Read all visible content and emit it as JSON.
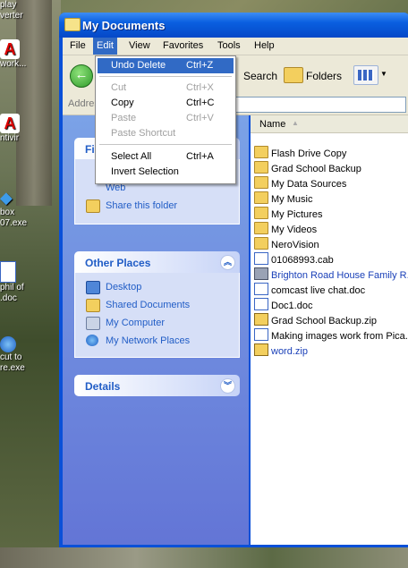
{
  "desktop": {
    "icons": [
      {
        "label": "play\nverter",
        "icon": "media-icon"
      },
      {
        "label": "work...",
        "icon": "antivirus-icon"
      },
      {
        "label": "ntivir",
        "icon": "antivirus-icon"
      },
      {
        "label": "box\n07.exe",
        "icon": "dropbox-icon"
      },
      {
        "label": "phil of\n.doc",
        "icon": "document-icon"
      },
      {
        "label": "cut to\nre.exe",
        "icon": "ie-icon"
      }
    ]
  },
  "window": {
    "title": "My Documents",
    "menu": [
      "File",
      "Edit",
      "View",
      "Favorites",
      "Tools",
      "Help"
    ],
    "active_menu": "Edit",
    "toolbar": {
      "search_label": "Search",
      "folders_label": "Folders"
    },
    "address_label": "Addres"
  },
  "edit_menu": {
    "items": [
      {
        "label": "Undo Delete",
        "shortcut": "Ctrl+Z",
        "state": "highlighted"
      },
      {
        "label": "Cut",
        "shortcut": "Ctrl+X",
        "state": "disabled"
      },
      {
        "label": "Copy",
        "shortcut": "Ctrl+C",
        "state": "enabled"
      },
      {
        "label": "Paste",
        "shortcut": "Ctrl+V",
        "state": "disabled"
      },
      {
        "label": "Paste Shortcut",
        "shortcut": "",
        "state": "disabled"
      },
      {
        "label": "Select All",
        "shortcut": "Ctrl+A",
        "state": "enabled"
      },
      {
        "label": "Invert Selection",
        "shortcut": "",
        "state": "enabled"
      }
    ]
  },
  "task_pane": {
    "file_tasks": {
      "title": "Fi",
      "items": [
        "Web",
        "Share this folder"
      ]
    },
    "other_places": {
      "title": "Other Places",
      "items": [
        "Desktop",
        "Shared Documents",
        "My Computer",
        "My Network Places"
      ]
    },
    "details": {
      "title": "Details"
    }
  },
  "file_list": {
    "column_name": "Name",
    "items": [
      {
        "name": "Flash Drive Copy",
        "type": "folder"
      },
      {
        "name": "Grad School Backup",
        "type": "folder"
      },
      {
        "name": "My Data Sources",
        "type": "folder"
      },
      {
        "name": "My Music",
        "type": "folder"
      },
      {
        "name": "My Pictures",
        "type": "folder"
      },
      {
        "name": "My Videos",
        "type": "folder"
      },
      {
        "name": "NeroVision",
        "type": "folder"
      },
      {
        "name": "01068993.cab",
        "type": "file"
      },
      {
        "name": "Brighton Road House Family R...",
        "type": "file",
        "highlight": true
      },
      {
        "name": "comcast live chat.doc",
        "type": "doc"
      },
      {
        "name": "Doc1.doc",
        "type": "doc"
      },
      {
        "name": "Grad School Backup.zip",
        "type": "zip"
      },
      {
        "name": "Making images work from Pica...",
        "type": "doc"
      },
      {
        "name": "word.zip",
        "type": "zip",
        "highlight": true
      }
    ]
  },
  "colors": {
    "title_blue": "#0a5fe0",
    "menu_highlight": "#316ac5",
    "task_pane": "#6375d6",
    "link_blue": "#215dc6"
  }
}
